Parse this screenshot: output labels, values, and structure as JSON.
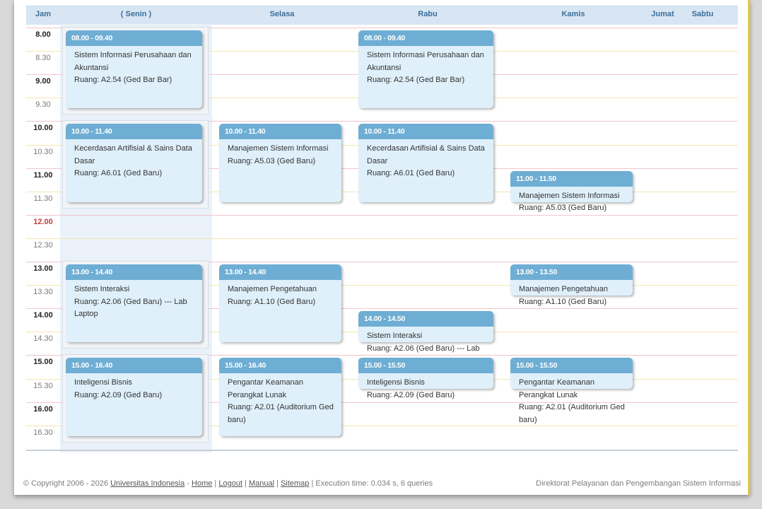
{
  "headers": {
    "jam": "Jam",
    "senin": "( Senin )",
    "selasa": "Selasa",
    "rabu": "Rabu",
    "kamis": "Kamis",
    "jumat": "Jumat",
    "sabtu": "Sabtu"
  },
  "times": [
    {
      "label": "8.00",
      "kind": "full"
    },
    {
      "label": "8.30",
      "kind": "half"
    },
    {
      "label": "9.00",
      "kind": "full"
    },
    {
      "label": "9.30",
      "kind": "half"
    },
    {
      "label": "10.00",
      "kind": "full"
    },
    {
      "label": "10.30",
      "kind": "half"
    },
    {
      "label": "11.00",
      "kind": "full"
    },
    {
      "label": "11.30",
      "kind": "half"
    },
    {
      "label": "12.00",
      "kind": "noon"
    },
    {
      "label": "12.30",
      "kind": "half"
    },
    {
      "label": "13.00",
      "kind": "full"
    },
    {
      "label": "13.30",
      "kind": "half"
    },
    {
      "label": "14.00",
      "kind": "full"
    },
    {
      "label": "14.30",
      "kind": "half"
    },
    {
      "label": "15.00",
      "kind": "full"
    },
    {
      "label": "15.30",
      "kind": "half"
    },
    {
      "label": "16.00",
      "kind": "full"
    },
    {
      "label": "16.30",
      "kind": "half"
    }
  ],
  "classes": [
    {
      "day": "senin",
      "time": "08.00 - 09.40",
      "course": "Sistem Informasi Perusahaan dan Akuntansi",
      "room": "Ruang: A2.54 (Ged Bar Bar)"
    },
    {
      "day": "senin",
      "time": "10.00 - 11.40",
      "course": "Kecerdasan Artifisial & Sains Data Dasar",
      "room": "Ruang: A6.01 (Ged Baru)"
    },
    {
      "day": "senin",
      "time": "13.00 - 14.40",
      "course": "Sistem Interaksi",
      "room": "Ruang: A2.06 (Ged Baru) --- Lab Laptop"
    },
    {
      "day": "senin",
      "time": "15.00 - 16.40",
      "course": "Inteligensi Bisnis",
      "room": "Ruang: A2.09 (Ged Baru)"
    },
    {
      "day": "selasa",
      "time": "10.00 - 11.40",
      "course": "Manajemen Sistem Informasi",
      "room": "Ruang: A5.03 (Ged Baru)"
    },
    {
      "day": "selasa",
      "time": "13.00 - 14.40",
      "course": "Manajemen Pengetahuan",
      "room": "Ruang: A1.10 (Ged Baru)"
    },
    {
      "day": "selasa",
      "time": "15.00 - 16.40",
      "course": "Pengantar Keamanan Perangkat Lunak",
      "room": "Ruang: A2.01 (Auditorium Ged baru)"
    },
    {
      "day": "rabu",
      "time": "08.00 - 09.40",
      "course": "Sistem Informasi Perusahaan dan Akuntansi",
      "room": "Ruang: A2.54 (Ged Bar Bar)"
    },
    {
      "day": "rabu",
      "time": "10.00 - 11.40",
      "course": "Kecerdasan Artifisial & Sains Data Dasar",
      "room": "Ruang: A6.01 (Ged Baru)"
    },
    {
      "day": "rabu",
      "time": "14.00 - 14.50",
      "course": "Sistem Interaksi",
      "room": "Ruang: A2.06 (Ged Baru) --- Lab"
    },
    {
      "day": "rabu",
      "time": "15.00 - 15.50",
      "course": "Inteligensi Bisnis",
      "room": "Ruang: A2.09 (Ged Baru)"
    },
    {
      "day": "kamis",
      "time": "11.00 - 11.50",
      "course": "Manajemen Sistem Informasi",
      "room": "Ruang: A5.03 (Ged Baru)"
    },
    {
      "day": "kamis",
      "time": "13.00 - 13.50",
      "course": "Manajemen Pengetahuan",
      "room": "Ruang: A1.10 (Ged Baru)"
    },
    {
      "day": "kamis",
      "time": "15.00 - 15.50",
      "course": "Pengantar Keamanan Perangkat Lunak",
      "room": "Ruang: A2.01 (Auditorium Ged baru)"
    }
  ],
  "footer": {
    "copyright": "© Copyright 2006 - 2026",
    "university": "Universitas Indonesia",
    "sep1": " - ",
    "home": "Home",
    "logout": "Logout",
    "manual": "Manual",
    "sitemap": "Sitemap",
    "pipe": " | ",
    "execution": " | Execution time: 0.034 s, 6 queries",
    "directorate": "Direktorat Pelayanan dan Pengembangan Sistem Informasi"
  }
}
